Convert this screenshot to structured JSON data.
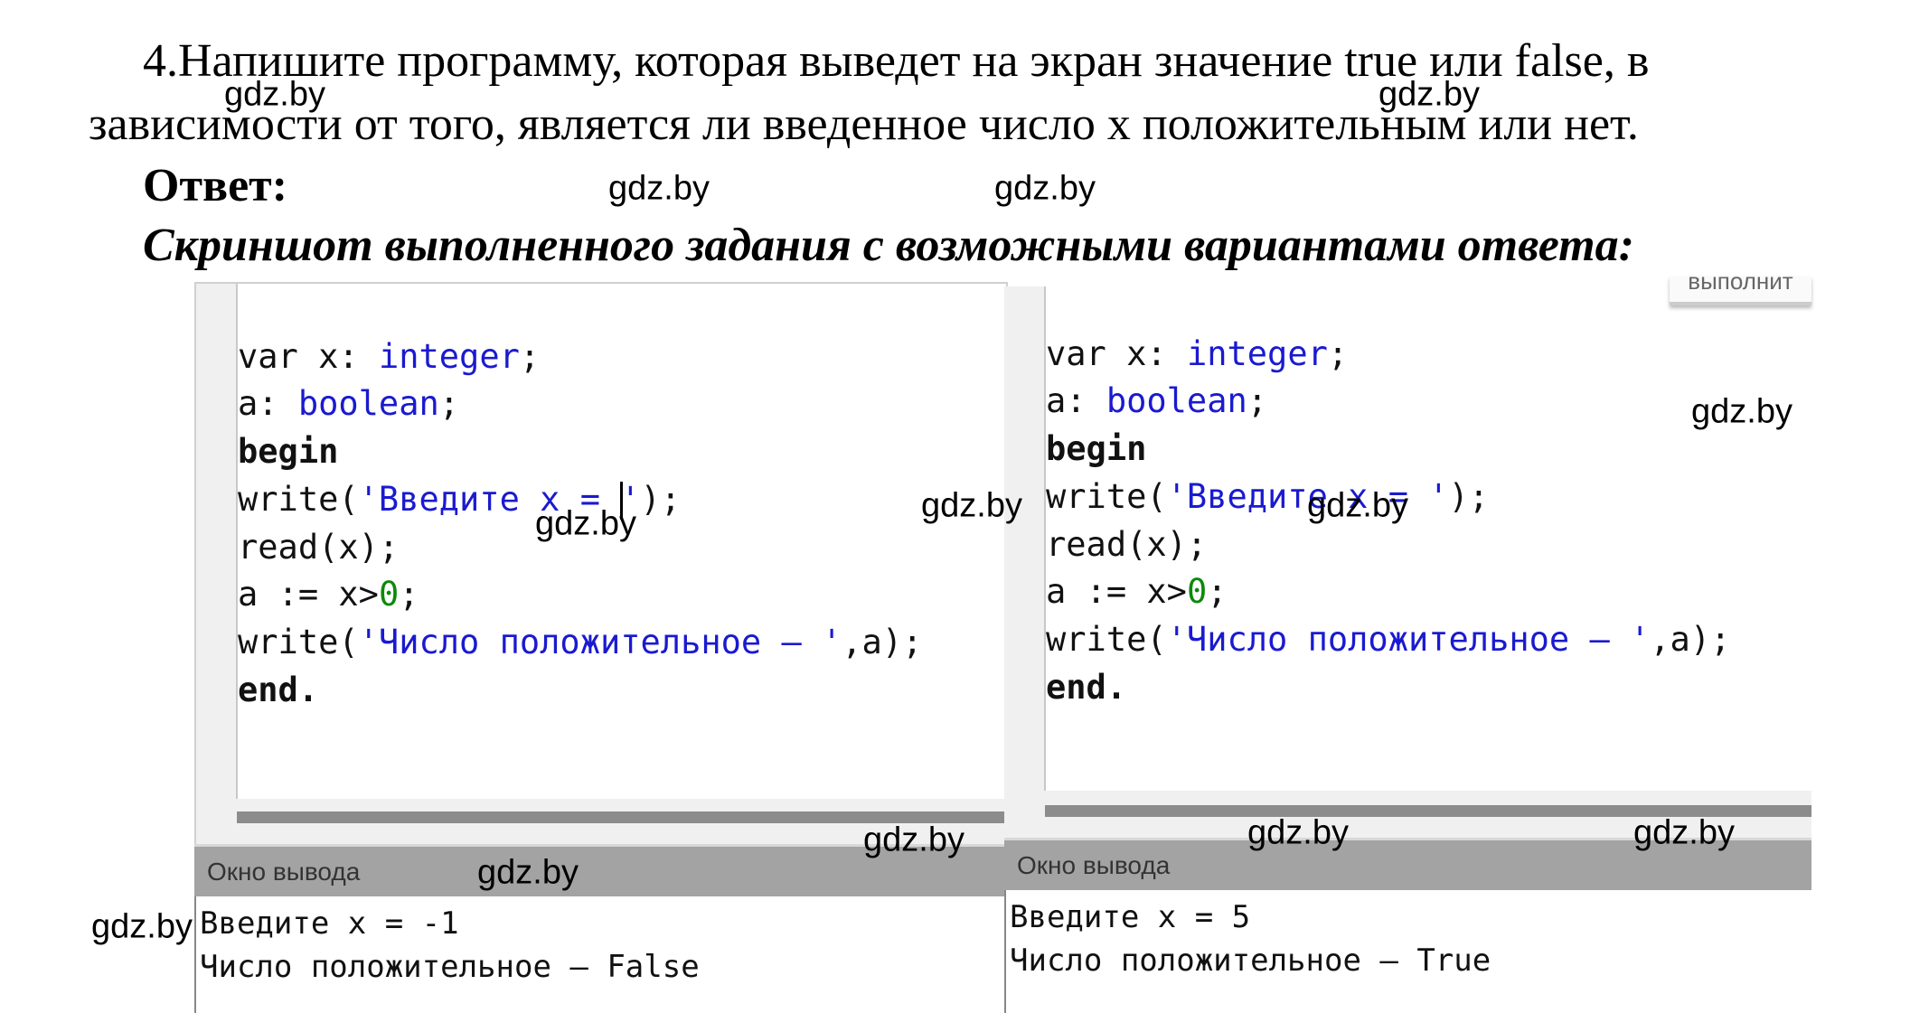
{
  "task": {
    "line1": "4.Напишите программу, которая выведет на экран значение true или false, в",
    "line2": "зависимости от того, является ли введенное число x положительным или нет.",
    "answer_label": "Ответ:",
    "caption": "Скриншот выполненного задания с возможными вариантами ответа:"
  },
  "code": {
    "l1": [
      "var x: ",
      "integer",
      ";"
    ],
    "l2": [
      "a: ",
      "boolean",
      ";"
    ],
    "l3": "begin",
    "l4": [
      "write(",
      "'Введите x = ",
      "'",
      ");"
    ],
    "l5": "read(x);",
    "l6": [
      "a := x>",
      "0",
      ";"
    ],
    "l7": [
      "write(",
      "'Число положительное – '",
      ",a);"
    ],
    "l8": "end."
  },
  "run_button_fragment": "выполнит",
  "output_header": "Окно вывода",
  "left_output": [
    "Введите x = -1",
    "Число положительное – False"
  ],
  "right_output": [
    "Введите x = 5",
    "Число положительное – True"
  ],
  "watermark": "gdz.by",
  "colors": {
    "keyword_type": "#1a1ad0",
    "number": "#0a8a0a",
    "output_header_bg": "#a3a3a3"
  }
}
